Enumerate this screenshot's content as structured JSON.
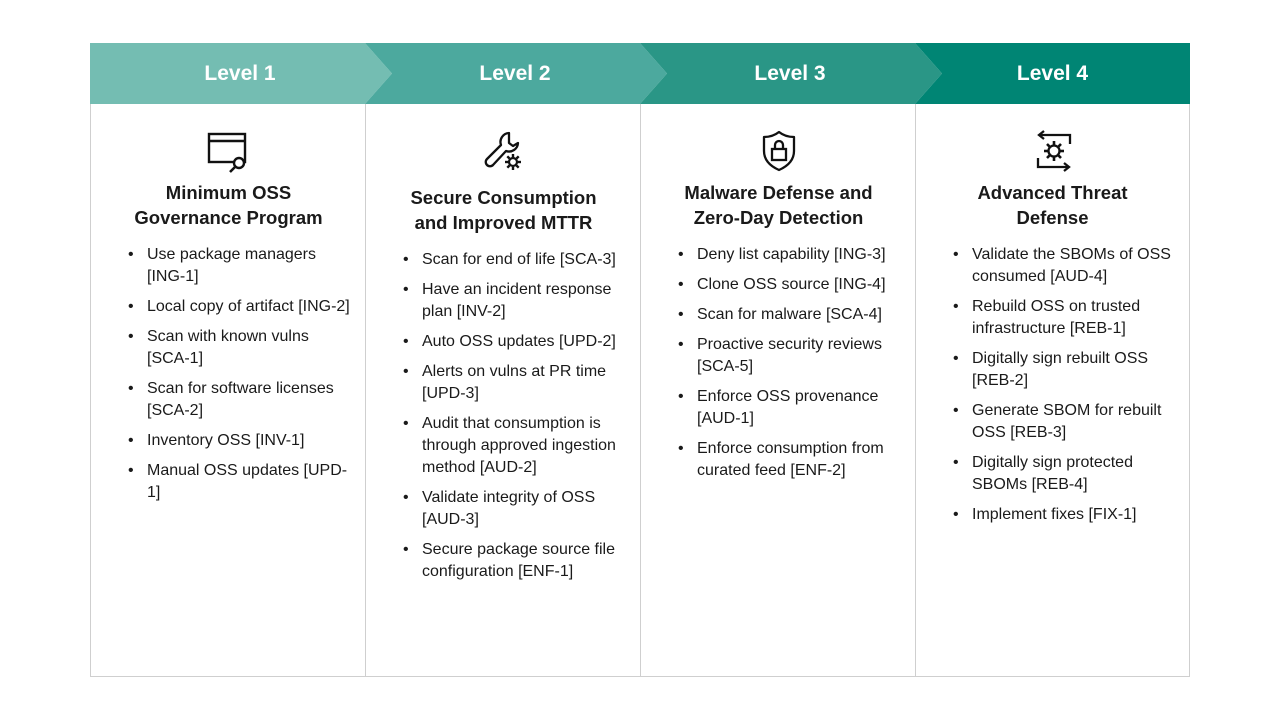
{
  "colors": {
    "level1": "#74bdb2",
    "level2": "#4ca99e",
    "level3": "#2a9686",
    "level4": "#008574",
    "border": "#cfcfcf"
  },
  "levels": [
    {
      "label": "Level 1",
      "icon": "window-search-icon",
      "title_lines": [
        "Minimum OSS",
        "Governance Program"
      ],
      "items": [
        "Use package managers [ING-1]",
        "Local copy of artifact [ING-2]",
        "Scan with known vulns [SCA-1]",
        "Scan for software licenses [SCA-2]",
        "Inventory OSS [INV-1]",
        "Manual OSS updates [UPD-1]"
      ]
    },
    {
      "label": "Level 2",
      "icon": "wrench-gear-icon",
      "title_lines": [
        "Secure Consumption",
        "and Improved MTTR"
      ],
      "items": [
        "Scan for end of life [SCA-3]",
        "Have an incident response plan [INV-2]",
        "Auto OSS updates [UPD-2]",
        "Alerts on vulns at PR time [UPD-3]",
        "Audit that consumption is through approved ingestion method [AUD-2]",
        "Validate integrity of OSS [AUD-3]",
        "Secure package source file configuration [ENF-1]"
      ]
    },
    {
      "label": "Level 3",
      "icon": "shield-lock-icon",
      "title_lines": [
        "Malware Defense and",
        "Zero-Day Detection"
      ],
      "items": [
        "Deny list capability [ING-3]",
        "Clone OSS source [ING-4]",
        "Scan for malware [SCA-4]",
        "Proactive security reviews [SCA-5]",
        "Enforce OSS provenance [AUD-1]",
        "Enforce consumption from curated feed [ENF-2]"
      ]
    },
    {
      "label": "Level 4",
      "icon": "gear-cycle-icon",
      "title_lines": [
        "Advanced Threat",
        "Defense"
      ],
      "items": [
        "Validate the SBOMs of OSS consumed [AUD-4]",
        "Rebuild OSS on trusted infrastructure [REB-1]",
        "Digitally sign rebuilt OSS [REB-2]",
        "Generate SBOM for rebuilt OSS [REB-3]",
        "Digitally sign protected SBOMs [REB-4]",
        "Implement fixes [FIX-1]"
      ]
    }
  ]
}
